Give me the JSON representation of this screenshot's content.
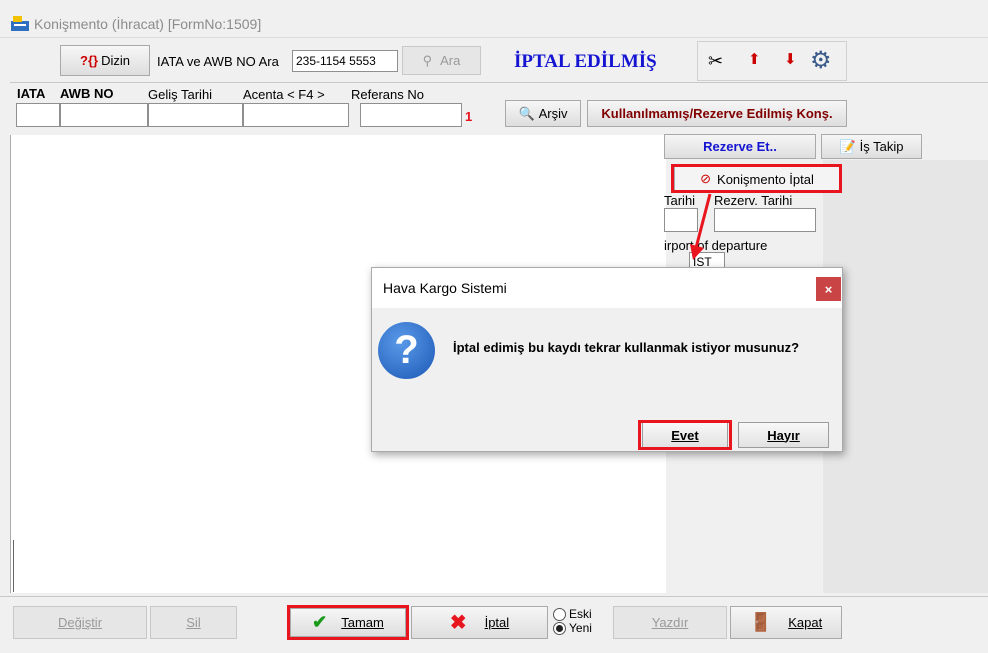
{
  "window": {
    "title": "Konişmento (İhracat) [FormNo:1509]"
  },
  "toolbar": {
    "dizin_label": "Dizin",
    "search_label": "IATA ve AWB NO Ara",
    "search_value": "235-1154 5553",
    "ara_label": "Ara",
    "status": "İPTAL EDİLMİŞ"
  },
  "fields": {
    "iata": "IATA",
    "awb": "AWB NO",
    "gelis": "Geliş Tarihi",
    "acenta": "Acenta < F4 >",
    "referans": "Referans No",
    "counter": "1"
  },
  "buttons": {
    "arsiv": "Arşiv",
    "unused": "Kullanılmamış/Rezerve Edilmiş Konş.",
    "rezerve": "Rezerve Et..",
    "is_takip": "İş Takip",
    "konismento_iptal": "Konişmento İptal"
  },
  "side": {
    "tarihi": "Tarihi",
    "rezerv_tarihi": "Rezerv. Tarihi",
    "airport": "irport of departure",
    "ist": "IST"
  },
  "dialog": {
    "title": "Hava Kargo Sistemi",
    "message": "İptal edimiş bu kaydı tekrar kullanmak istiyor musunuz?",
    "yes": "Evet",
    "no": "Hayır"
  },
  "bottom": {
    "degistir": "Değiştir",
    "sil": "Sil",
    "tamam": "Tamam",
    "iptal": "İptal",
    "eski": "Eski",
    "yeni": "Yeni",
    "yazdir": "Yazdır",
    "kapat": "Kapat"
  },
  "colors": {
    "status_blue": "#1414d2",
    "highlight_red": "#e8141e",
    "maroon": "#800000"
  }
}
